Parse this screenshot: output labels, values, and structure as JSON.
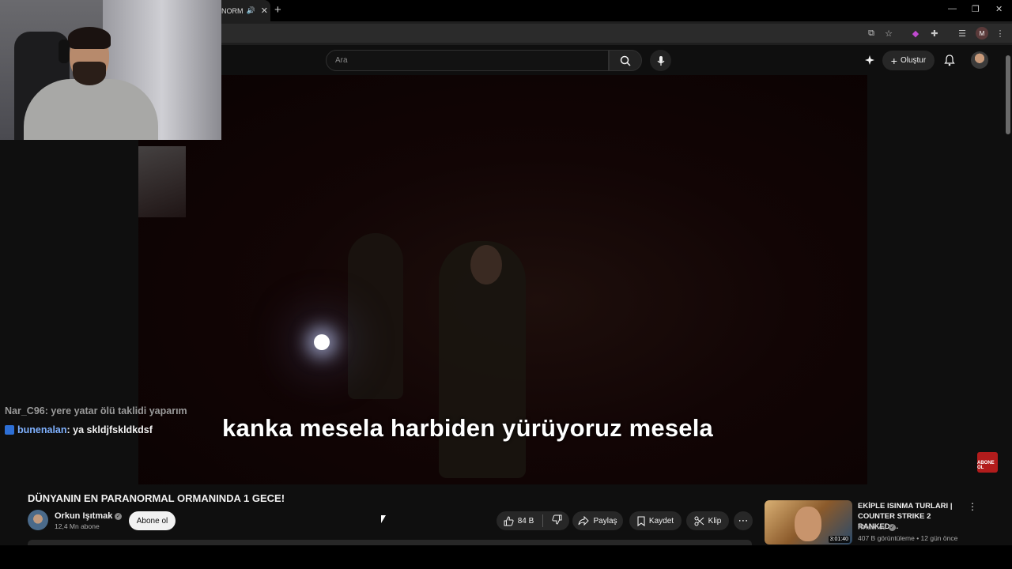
{
  "browser": {
    "tab_title": "NORM",
    "tab_audio_icon": "speaker-icon",
    "profile_initial": "M"
  },
  "header": {
    "search_placeholder": "Ara",
    "create_label": "Oluştur"
  },
  "video": {
    "subtitle": "kanka mesela harbiden yürüyoruz mesela",
    "badge_text": "ABONE OL"
  },
  "chat": [
    {
      "user": "Nar_C96",
      "message": " : yere yatar ölü taklidi yaparım",
      "dim": true
    },
    {
      "user": "bunenalan",
      "message": " : ya skldjfskldkdsf",
      "dim": false
    }
  ],
  "meta": {
    "title": "DÜNYANIN EN PARANORMAL ORMANINDA 1 GECE!",
    "channel_name": "Orkun Işıtmak",
    "subscribers": "12,4 Mn abone",
    "subscribe_label": "Abone ol",
    "likes": "84 B",
    "share_label": "Paylaş",
    "save_label": "Kaydet",
    "clip_label": "Klip"
  },
  "recommended": {
    "title": "EKİPLE ISINMA TURLARI | COUNTER STRIKE 2 RANKED ...",
    "channel": "RRaenee",
    "stats": "407 B görüntüleme • 12 gün önce",
    "duration": "3:01:40"
  }
}
